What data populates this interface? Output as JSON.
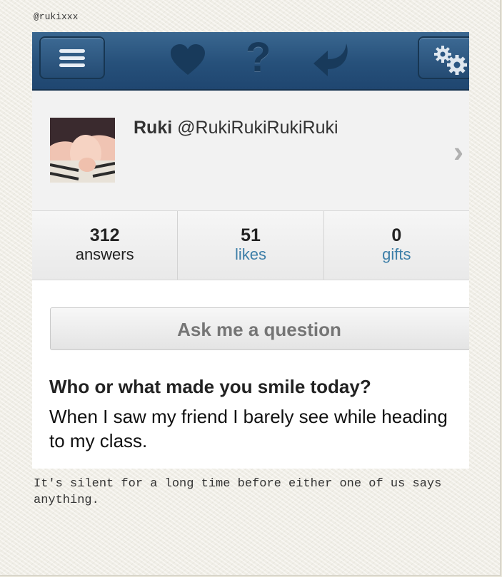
{
  "handle": "@rukixxx",
  "navbar": {
    "icons": [
      "menu-icon",
      "heart-icon",
      "help-icon",
      "back-arrow-icon",
      "settings-gear-icon"
    ],
    "help_glyph": "?"
  },
  "profile": {
    "display_name": "Ruki",
    "username": "@RukiRukiRukiRuki"
  },
  "stats": [
    {
      "count": "312",
      "label": "answers"
    },
    {
      "count": "51",
      "label": "likes"
    },
    {
      "count": "0",
      "label": "gifts"
    }
  ],
  "ask_button": "Ask me a question",
  "post": {
    "question": "Who or what made you smile today?",
    "answer": "When I saw my friend I barely see while heading to my class."
  },
  "caption": "It's silent for a long time before either one of us says anything.",
  "colors": {
    "navbar": "#26507a",
    "link": "#3e7fa8",
    "paper": "#f1efe6"
  }
}
